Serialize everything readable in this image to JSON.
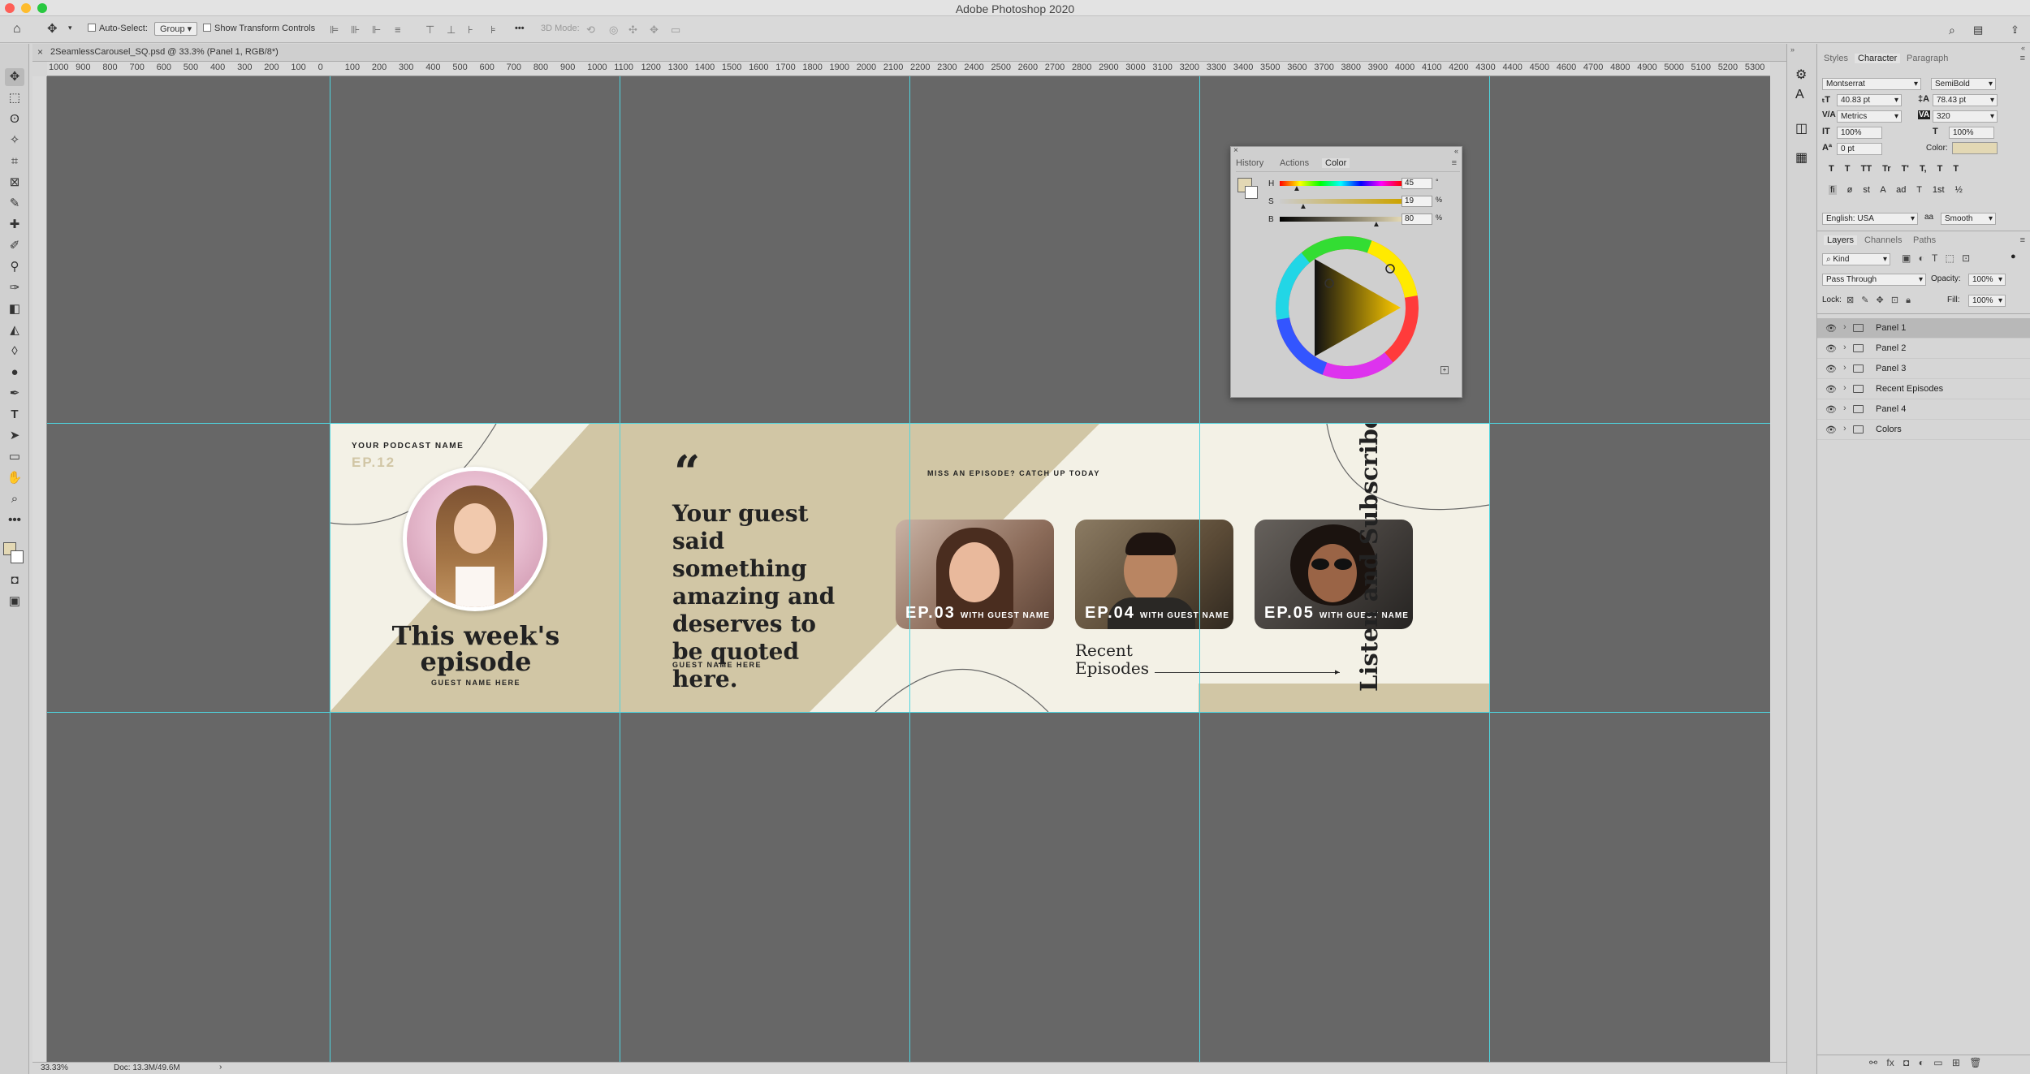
{
  "window": {
    "title": "Adobe Photoshop 2020"
  },
  "options_bar": {
    "auto_select_label": "Auto-Select:",
    "auto_select_value": "Group",
    "transform_label": "Show Transform Controls",
    "mode_3d": "3D Mode:"
  },
  "document": {
    "tab_label": "2SeamlessCarousel_SQ.psd @ 33.3% (Panel 1, RGB/8*)"
  },
  "ruler_ticks": [
    "1000",
    "900",
    "800",
    "700",
    "600",
    "500",
    "400",
    "300",
    "200",
    "100",
    "0",
    "100",
    "200",
    "300",
    "400",
    "500",
    "600",
    "700",
    "800",
    "900",
    "1000",
    "1100",
    "1200",
    "1300",
    "1400",
    "1500",
    "1600",
    "1700",
    "1800",
    "1900",
    "2000",
    "2100",
    "2200",
    "2300",
    "2400",
    "2500",
    "2600",
    "2700",
    "2800",
    "2900",
    "3000",
    "3100",
    "3200",
    "3300",
    "3400",
    "3500",
    "3600",
    "3700",
    "3800",
    "3900",
    "4000",
    "4100",
    "4200",
    "4300",
    "4400",
    "4500",
    "4600",
    "4700",
    "4800",
    "4900",
    "5000",
    "5100",
    "5200",
    "5300"
  ],
  "artboard": {
    "podcast_name": "YOUR PODCAST NAME",
    "ep_number": "EP.12",
    "headline_1": "This week's",
    "headline_2": "episode",
    "guest_name": "GUEST NAME HERE",
    "quote_mark": "“",
    "quote": "Your guest said something amazing and deserves to be quoted here.",
    "quote_guest": "GUEST NAME HERE",
    "catchup": "MISS AN EPISODE? CATCH UP TODAY",
    "episodes": [
      {
        "ep": "EP.03",
        "sub": "WITH GUEST NAME"
      },
      {
        "ep": "EP.04",
        "sub": "WITH GUEST NAME"
      },
      {
        "ep": "EP.05",
        "sub": "WITH GUEST NAME"
      }
    ],
    "recent_1": "Recent",
    "recent_2": "Episodes",
    "vertical": "Listen and Subscribe",
    "colors": {
      "cream": "#f3f1e6",
      "tan": "#d1c6a5",
      "dark": "#222222"
    }
  },
  "status": {
    "zoom": "33.33%",
    "doc": "Doc: 13.3M/49.6M"
  },
  "color_panel": {
    "tabs": [
      "History",
      "Actions",
      "Color"
    ],
    "active_tab": "Color",
    "h_label": "H",
    "h_value": "45",
    "h_unit": "°",
    "s_label": "S",
    "s_value": "19",
    "s_unit": "%",
    "b_label": "B",
    "b_value": "80",
    "b_unit": "%"
  },
  "character_panel": {
    "tabs": [
      "Styles",
      "Character",
      "Paragraph"
    ],
    "font": "Montserrat",
    "style": "SemiBold",
    "size": "40.83 pt",
    "leading": "78.43 pt",
    "kerning": "Metrics",
    "tracking": "320",
    "vscale": "100%",
    "hscale": "100%",
    "baseline": "0 pt",
    "color_label": "Color:",
    "language": "English: USA",
    "aa_label": "aa",
    "antialias": "Smooth",
    "type_buttons": [
      "T",
      "T",
      "TT",
      "Tr",
      "T'",
      "T,",
      "T",
      "T"
    ],
    "ot_buttons": [
      "fi",
      "ø",
      "st",
      "A",
      "ad",
      "T",
      "1st",
      "½"
    ]
  },
  "layers_panel": {
    "tabs": [
      "Layers",
      "Channels",
      "Paths"
    ],
    "kind": "Kind",
    "blend": "Pass Through",
    "opacity_label": "Opacity:",
    "opacity": "100%",
    "lock_label": "Lock:",
    "fill_label": "Fill:",
    "fill": "100%",
    "layers": [
      "Panel 1",
      "Panel 2",
      "Panel 3",
      "Recent Episodes",
      "Panel 4",
      "Colors"
    ]
  }
}
